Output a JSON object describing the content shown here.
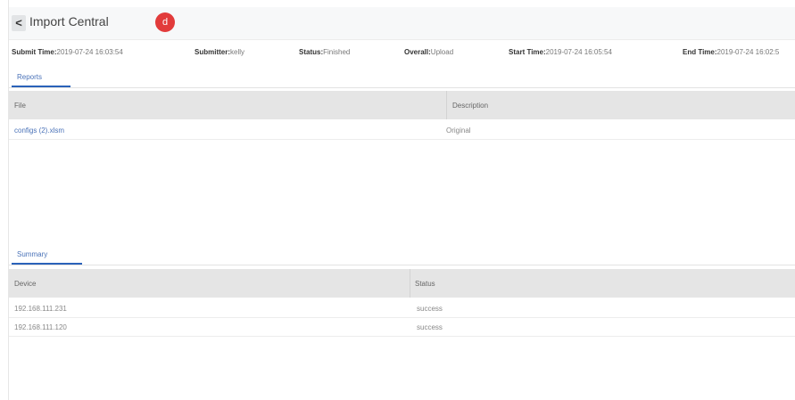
{
  "header": {
    "back_icon": "chevron-left-icon",
    "back_glyph": "<",
    "title": "Import Central",
    "badge": "d",
    "badge_color": "#e23b3b"
  },
  "info": {
    "submit_time_label": "Submit Time:",
    "submit_time_value": "2019-07-24 16:03:54",
    "submitter_label": "Submitter:",
    "submitter_value": "kelly",
    "status_label": "Status:",
    "status_value": "Finished",
    "overall_label": "Overall:",
    "overall_value": "Upload",
    "start_time_label": "Start Time:",
    "start_time_value": "2019-07-24 16:05:54",
    "end_time_label": "End Time:",
    "end_time_value": "2019-07-24 16:02:5"
  },
  "reports": {
    "tab_label": "Reports",
    "columns": [
      "File",
      "Description"
    ],
    "rows": [
      {
        "file": "configs (2).xlsm",
        "description": "Original"
      }
    ]
  },
  "summary": {
    "tab_label": "Summary",
    "columns": [
      "Device",
      "Status"
    ],
    "rows": [
      {
        "device": "192.168.111.231",
        "status": "success"
      },
      {
        "device": "192.168.111.120",
        "status": "success"
      }
    ]
  },
  "colors": {
    "accent": "#2a62b9",
    "link": "#4a72b8",
    "table_header_bg": "#e5e5e5"
  }
}
